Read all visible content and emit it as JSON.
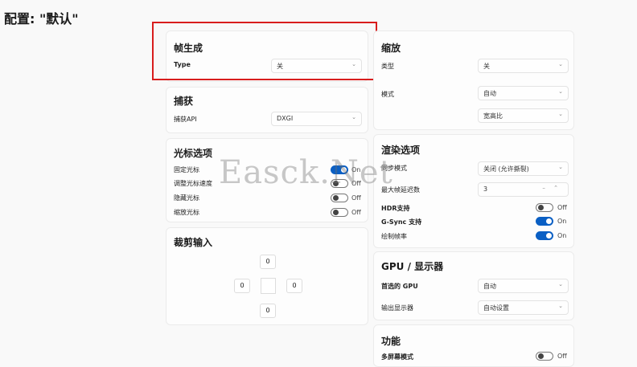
{
  "page_title": "配置: \"默认\"",
  "frame_gen": {
    "title": "帧生成",
    "type_label": "Type",
    "type_value": "关"
  },
  "capture": {
    "title": "捕获",
    "api_label": "捕获API",
    "api_value": "DXGI"
  },
  "cursor": {
    "title": "光标选项",
    "rows": [
      {
        "label": "固定光标",
        "state": "On",
        "on": true
      },
      {
        "label": "调整光标速度",
        "state": "Off",
        "on": false
      },
      {
        "label": "隐藏光标",
        "state": "Off",
        "on": false
      },
      {
        "label": "缩放光标",
        "state": "Off",
        "on": false
      }
    ]
  },
  "crop": {
    "title": "裁剪输入",
    "top": "0",
    "left": "0",
    "right": "0",
    "bottom": "0"
  },
  "scaling": {
    "title": "缩放",
    "type_label": "类型",
    "type_value": "关",
    "mode_label": "模式",
    "mode_value": "自动",
    "aspect_value": "宽高比"
  },
  "render": {
    "title": "渲染选项",
    "vsync_label": "同步模式",
    "vsync_value": "关闭 (允许撕裂)",
    "maxframes_label": "最大帧延迟数",
    "maxframes_value": "3",
    "hdr_label": "HDR支持",
    "hdr_state": "Off",
    "gsync_label": "G-Sync 支持",
    "gsync_state": "On",
    "drawfps_label": "绘制帧率",
    "drawfps_state": "On"
  },
  "gpu": {
    "title": "GPU / 显示器",
    "gpu_label": "首选的 GPU",
    "gpu_value": "自动",
    "display_label": "输出显示器",
    "display_value": "自动设置"
  },
  "features": {
    "title": "功能",
    "multi_label": "多屏幕模式",
    "multi_state": "Off"
  },
  "watermark": "Easck.Net",
  "colors": {
    "accent": "#0a5fc4",
    "highlight": "#d81d1d"
  }
}
